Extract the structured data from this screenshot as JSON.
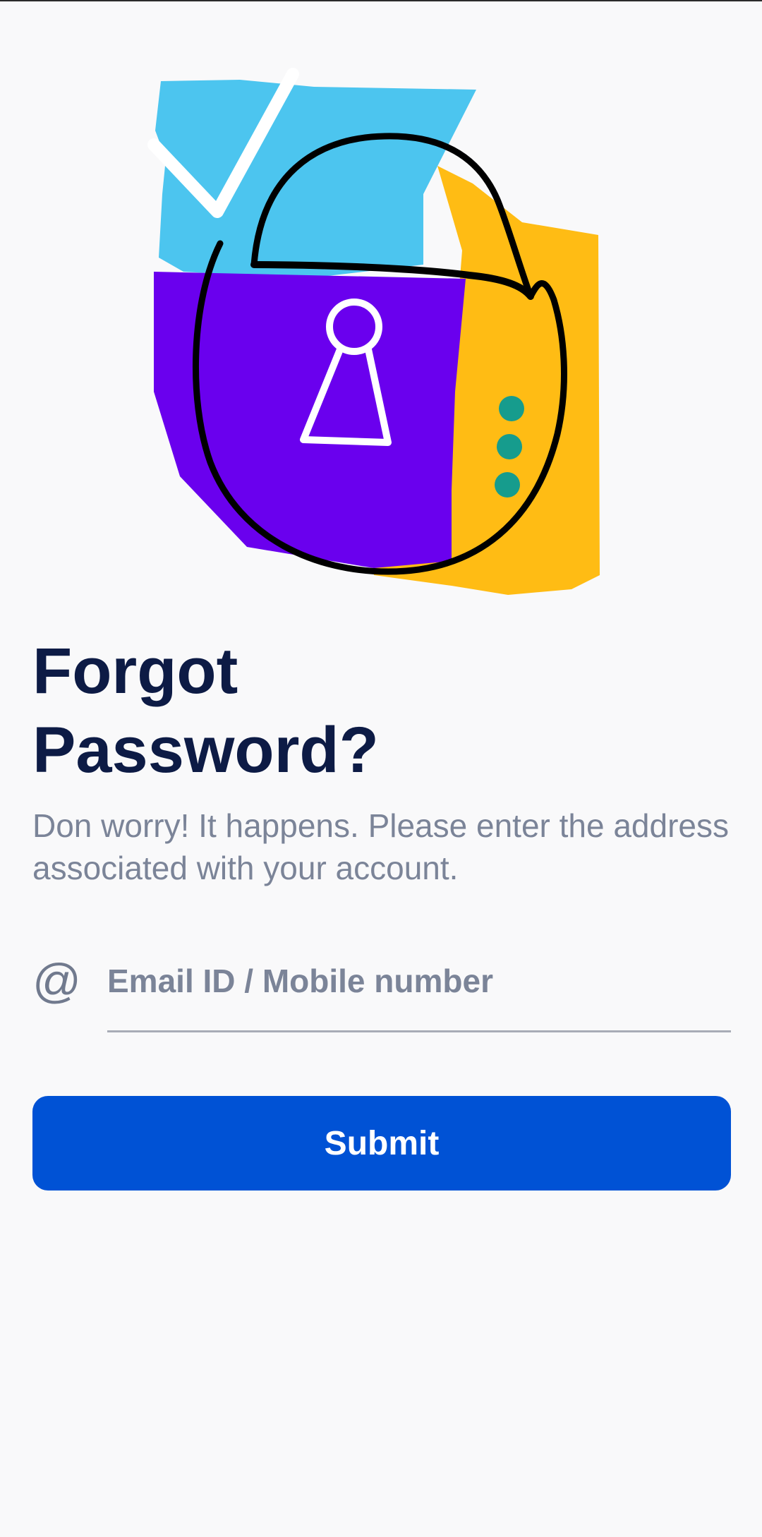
{
  "page": {
    "title": "Forgot\nPassword?",
    "subtitle": "Don  worry! It happens. Please enter the address associated with your account."
  },
  "form": {
    "email_icon": "@",
    "email_placeholder": "Email ID / Mobile number",
    "email_value": "",
    "submit_label": "Submit"
  },
  "illustration": {
    "icon": "padlock-illustration",
    "colors": {
      "blue": "#4cc5ef",
      "purple": "#6a00ee",
      "yellow": "#ffbc14",
      "teal": "#169c8d",
      "outline": "#000000"
    }
  },
  "colors": {
    "background": "#f9f9fa",
    "title": "#0d1b45",
    "muted_text": "#7b8498",
    "button": "#0052d5",
    "button_text": "#ffffff"
  }
}
